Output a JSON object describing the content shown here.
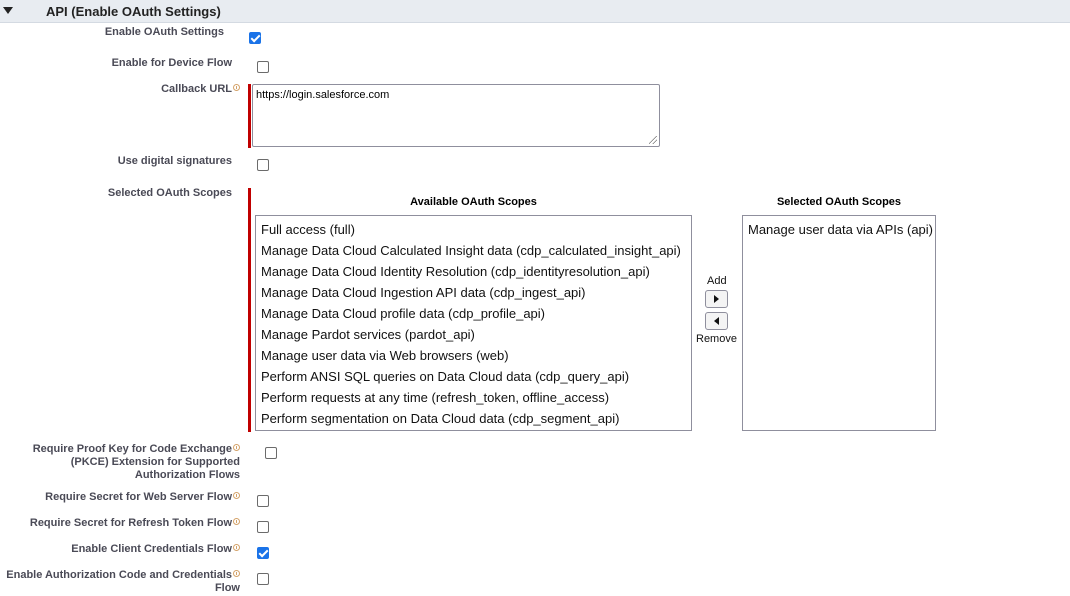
{
  "section": {
    "title": "API (Enable OAuth Settings)"
  },
  "fields": {
    "enable_oauth": {
      "label": "Enable OAuth Settings",
      "checked": true
    },
    "device_flow": {
      "label": "Enable for Device Flow",
      "checked": false
    },
    "callback_url": {
      "label": "Callback URL",
      "value": "https://login.salesforce.com"
    },
    "digital_signatures": {
      "label": "Use digital signatures",
      "checked": false
    },
    "selected_scopes": {
      "label": "Selected OAuth Scopes"
    },
    "pkce": {
      "label_line1": "Require Proof Key for Code Exchange",
      "label_line2": "(PKCE) Extension for Supported",
      "label_line3": "Authorization Flows",
      "checked": false
    },
    "secret_web_server": {
      "label": "Require Secret for Web Server Flow",
      "checked": false
    },
    "secret_refresh": {
      "label": "Require Secret for Refresh Token Flow",
      "checked": false
    },
    "client_credentials": {
      "label": "Enable Client Credentials Flow",
      "checked": true
    },
    "auth_code_credentials": {
      "label_line1": "Enable Authorization Code and Credentials",
      "label_line2": "Flow",
      "checked": false
    }
  },
  "scopes": {
    "available_header": "Available OAuth Scopes",
    "selected_header": "Selected OAuth Scopes",
    "available": [
      "Full access (full)",
      "Manage Data Cloud Calculated Insight data (cdp_calculated_insight_api)",
      "Manage Data Cloud Identity Resolution (cdp_identityresolution_api)",
      "Manage Data Cloud Ingestion API data (cdp_ingest_api)",
      "Manage Data Cloud profile data (cdp_profile_api)",
      "Manage Pardot services (pardot_api)",
      "Manage user data via Web browsers (web)",
      "Perform ANSI SQL queries on Data Cloud data (cdp_query_api)",
      "Perform requests at any time (refresh_token, offline_access)",
      "Perform segmentation on Data Cloud data (cdp_segment_api)"
    ],
    "selected": [
      "Manage user data via APIs (api)"
    ],
    "add_label": "Add",
    "remove_label": "Remove"
  },
  "colors": {
    "required": "#c00000",
    "checkbox_checked": "#1a73e8",
    "section_bg": "#e8ecf1"
  }
}
